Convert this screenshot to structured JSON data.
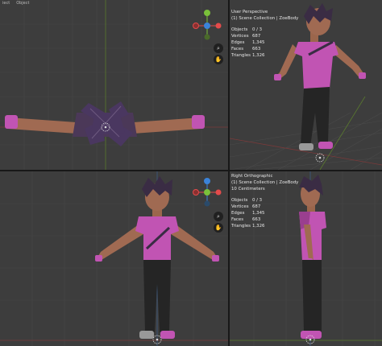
{
  "header": {
    "menu_items": [
      "iect",
      "Object"
    ]
  },
  "viewports": {
    "top_right": {
      "view_name": "User Perspective",
      "collection": "(1) Scene Collection | ZoeBody",
      "stats": [
        {
          "label": "Objects",
          "value": "0 / 3"
        },
        {
          "label": "Vertices",
          "value": "687"
        },
        {
          "label": "Edges",
          "value": "1,345"
        },
        {
          "label": "Faces",
          "value": "663"
        },
        {
          "label": "Triangles",
          "value": "1,326"
        }
      ]
    },
    "bottom_right": {
      "view_name": "Right Orthographic",
      "collection": "(1) Scene Collection | ZoeBody",
      "scale": "10 Centimeters",
      "stats": [
        {
          "label": "Objects",
          "value": "0 / 3"
        },
        {
          "label": "Vertices",
          "value": "687"
        },
        {
          "label": "Edges",
          "value": "1,345"
        },
        {
          "label": "Faces",
          "value": "663"
        },
        {
          "label": "Triangles",
          "value": "1,326"
        }
      ]
    }
  },
  "gizmo": {
    "y_label": "Y",
    "z_label": "Z",
    "x_label": "X"
  },
  "colors": {
    "x_axis": "#e44b4b",
    "y_axis": "#7ac13a",
    "z_axis": "#3b83d9",
    "shirt": "#c154b3",
    "skin": "#b07a5e",
    "hair": "#3a2c44",
    "pants": "#252525"
  }
}
